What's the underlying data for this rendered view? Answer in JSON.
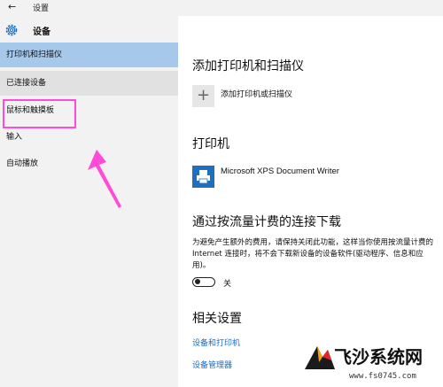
{
  "window": {
    "title": "设置"
  },
  "sidebar": {
    "section_title": "设备",
    "items": [
      {
        "label": "打印机和扫描仪",
        "state": "selected"
      },
      {
        "label": "已连接设备",
        "state": "hover"
      },
      {
        "label": "鼠标和触摸板",
        "state": "annotated"
      },
      {
        "label": "输入",
        "state": "normal"
      },
      {
        "label": "自动播放",
        "state": "normal"
      }
    ]
  },
  "main": {
    "add_heading": "添加打印机和扫描仪",
    "add_button_label": "添加打印机或扫描仪",
    "printers_heading": "打印机",
    "printers": [
      {
        "name": "Microsoft XPS Document Writer"
      }
    ],
    "metered_heading": "通过按流量计费的连接下载",
    "metered_desc": "为避免产生额外的费用，请保持关闭此功能，这样当你使用按流量计费的 Internet 连接时，将不会下载新设备的设备软件(驱动程序、信息和应用)。",
    "toggle_state": "关",
    "related_heading": "相关设置",
    "related_links": [
      "设备和打印机",
      "设备管理器"
    ]
  },
  "annotation": {
    "highlight_color": "#ff4bd8"
  },
  "watermark": {
    "text": "飞沙系统网",
    "url": "www.fs0745.com"
  },
  "colors": {
    "accent": "#1e6fbf",
    "selected": "#a6c8ea",
    "hover": "#e1e1e1",
    "link": "#1a6bc4"
  }
}
